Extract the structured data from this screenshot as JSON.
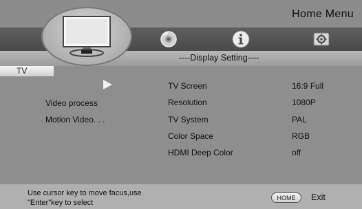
{
  "header": {
    "title": "Home Menu"
  },
  "tabs": [
    {
      "icon": "tv-icon",
      "active": true
    },
    {
      "icon": "disc-icon",
      "active": false
    },
    {
      "icon": "info-icon",
      "active": false
    },
    {
      "icon": "gear-icon",
      "active": false
    }
  ],
  "section": {
    "title": "----Display Setting----"
  },
  "menu": {
    "items": [
      {
        "label": "TV",
        "selected": true
      },
      {
        "label": "Video process",
        "selected": false
      },
      {
        "label": "Motion Video. . .",
        "selected": false
      }
    ]
  },
  "settings": [
    {
      "label": "TV Screen",
      "value": "16:9 Full"
    },
    {
      "label": "Resolution",
      "value": "1080P"
    },
    {
      "label": "TV System",
      "value": "PAL"
    },
    {
      "label": "Color Space",
      "value": "RGB"
    },
    {
      "label": "HDMI Deep Color",
      "value": "off"
    }
  ],
  "footer": {
    "hint_line1": "Use cursor key to move facus,use",
    "hint_line2": "\"Enter\"key to select",
    "home_button": "HOME",
    "exit_label": "Exit"
  }
}
